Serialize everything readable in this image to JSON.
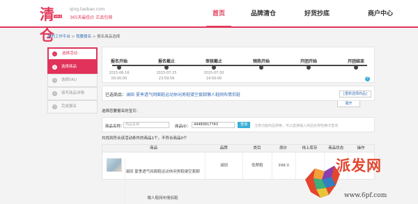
{
  "header": {
    "logo_text": "清仓",
    "logo_badge": "SALE",
    "site_url": "qing.taobao.com",
    "slogan": "365天最低价 正品包邮",
    "nav": [
      "首页",
      "品牌清仓",
      "好货抄底",
      "商户中心"
    ],
    "active_nav": 0,
    "accent_color": "#e0325a"
  },
  "breadcrumb": {
    "items": [
      "我的工作平台",
      "我要报名",
      "报名商品选择"
    ],
    "separator": ">"
  },
  "sidebar": {
    "items": [
      {
        "label": "选择活动",
        "icon": "check-icon",
        "icon_char": "✓",
        "state": "done"
      },
      {
        "label": "选择商品",
        "icon": "step-2-icon",
        "icon_char": "2",
        "state": "current"
      },
      {
        "label": "选择SKU",
        "icon": "step-3-icon",
        "icon_char": "3",
        "state": "pending"
      },
      {
        "label": "填写商品详情",
        "icon": "step-4-icon",
        "icon_char": "4",
        "state": "pending"
      },
      {
        "label": "完成报名",
        "icon": "step-5-icon",
        "icon_char": "5",
        "state": "pending"
      }
    ]
  },
  "timeline": {
    "steps": [
      {
        "label": "报名开始",
        "date": "2015-06-16",
        "time": "00:00:00"
      },
      {
        "label": "报名截止",
        "date": "2015-07-25",
        "time": "23:59:59"
      },
      {
        "label": "审核截止",
        "date": "2015-07-30",
        "time": "14:00:00"
      },
      {
        "label": "预热开始",
        "date": "",
        "time": ""
      },
      {
        "label": "开团开始",
        "date": "",
        "time": ""
      },
      {
        "label": "开团结束",
        "date": "",
        "time": ""
      }
    ],
    "help_char": "?"
  },
  "selected": {
    "prefix": "已选商品：",
    "shop": "澜田",
    "goods_name": "夏季透气网面鞋运动休闲男鞋镂空套脚懒人鞋网布情侣鞋",
    "reselect_label": "[重新选择商品]",
    "expand_label": "展开"
  },
  "search": {
    "choose_tip": "选择您要报名的宝贝：",
    "name_label": "商品名称：",
    "name_placeholder": "商品名称",
    "id_label": "商品ID：",
    "id_value": "44489917743",
    "button_label": "查询",
    "hint": "注意功能商品搜索，可以直接输入商品名称检索ID查询"
  },
  "result_tip": "共找到符合该活动条件的商品1个，不符合商品0个",
  "table": {
    "headers": [
      "商品",
      "品牌",
      "类目",
      "原价",
      "线上库存",
      "商品状态",
      "操作"
    ],
    "rows": [
      {
        "title": "澜田 夏季透气网面鞋运动休闲男鞋镂空套脚懒人鞋网布情侣鞋",
        "brand": "澜田",
        "category": "低帮鞋",
        "price": "398.0",
        "stock": "",
        "status": "",
        "action": ""
      }
    ]
  },
  "watermark": {
    "text": "派发网",
    "url": "www.6pf.com"
  }
}
